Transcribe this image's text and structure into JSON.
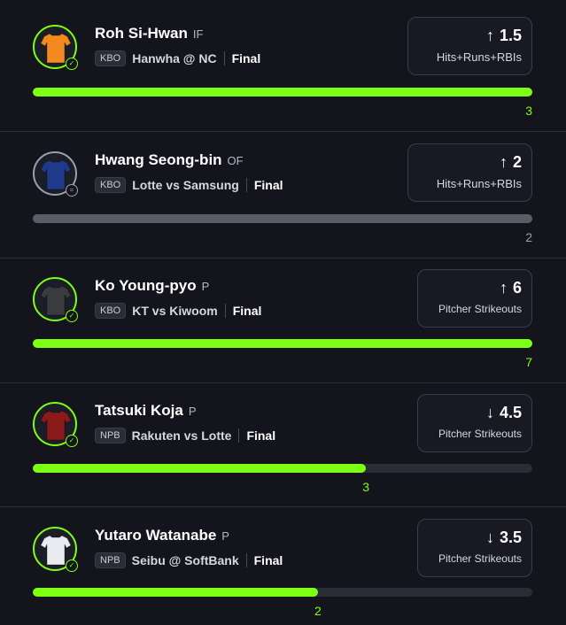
{
  "colors": {
    "accent": "#7dff14",
    "neutral": "#9aa0ad",
    "background": "#13141c"
  },
  "picks": [
    {
      "name": "Roh Si-Hwan",
      "position": "IF",
      "league": "KBO",
      "matchup": "Hanwha @ NC",
      "status": "Final",
      "direction": "up",
      "arrow": "↑",
      "line": "1.5",
      "stat": "Hits+Runs+RBIs",
      "result": "3",
      "progress": 1.0,
      "result_state": "hit",
      "jersey_color": "#f28a20",
      "jersey_icon": "jersey-icon"
    },
    {
      "name": "Hwang Seong-bin",
      "position": "OF",
      "league": "KBO",
      "matchup": "Lotte vs Samsung",
      "status": "Final",
      "direction": "up",
      "arrow": "↑",
      "line": "2",
      "stat": "Hits+Runs+RBIs",
      "result": "2",
      "progress": 1.0,
      "result_state": "push",
      "jersey_color": "#1f3a8a",
      "jersey_icon": "jersey-icon"
    },
    {
      "name": "Ko Young-pyo",
      "position": "P",
      "league": "KBO",
      "matchup": "KT vs Kiwoom",
      "status": "Final",
      "direction": "up",
      "arrow": "↑",
      "line": "6",
      "stat": "Pitcher Strikeouts",
      "result": "7",
      "progress": 1.0,
      "result_state": "hit",
      "jersey_color": "#3a3b3f",
      "jersey_icon": "jersey-icon"
    },
    {
      "name": "Tatsuki Koja",
      "position": "P",
      "league": "NPB",
      "matchup": "Rakuten vs Lotte",
      "status": "Final",
      "direction": "down",
      "arrow": "↓",
      "line": "4.5",
      "stat": "Pitcher Strikeouts",
      "result": "3",
      "progress": 0.667,
      "result_state": "hit",
      "jersey_color": "#8b1a1a",
      "jersey_icon": "jersey-icon"
    },
    {
      "name": "Yutaro Watanabe",
      "position": "P",
      "league": "NPB",
      "matchup": "Seibu @ SoftBank",
      "status": "Final",
      "direction": "down",
      "arrow": "↓",
      "line": "3.5",
      "stat": "Pitcher Strikeouts",
      "result": "2",
      "progress": 0.571,
      "result_state": "hit",
      "jersey_color": "#e9ebf0",
      "jersey_icon": "jersey-icon"
    }
  ]
}
